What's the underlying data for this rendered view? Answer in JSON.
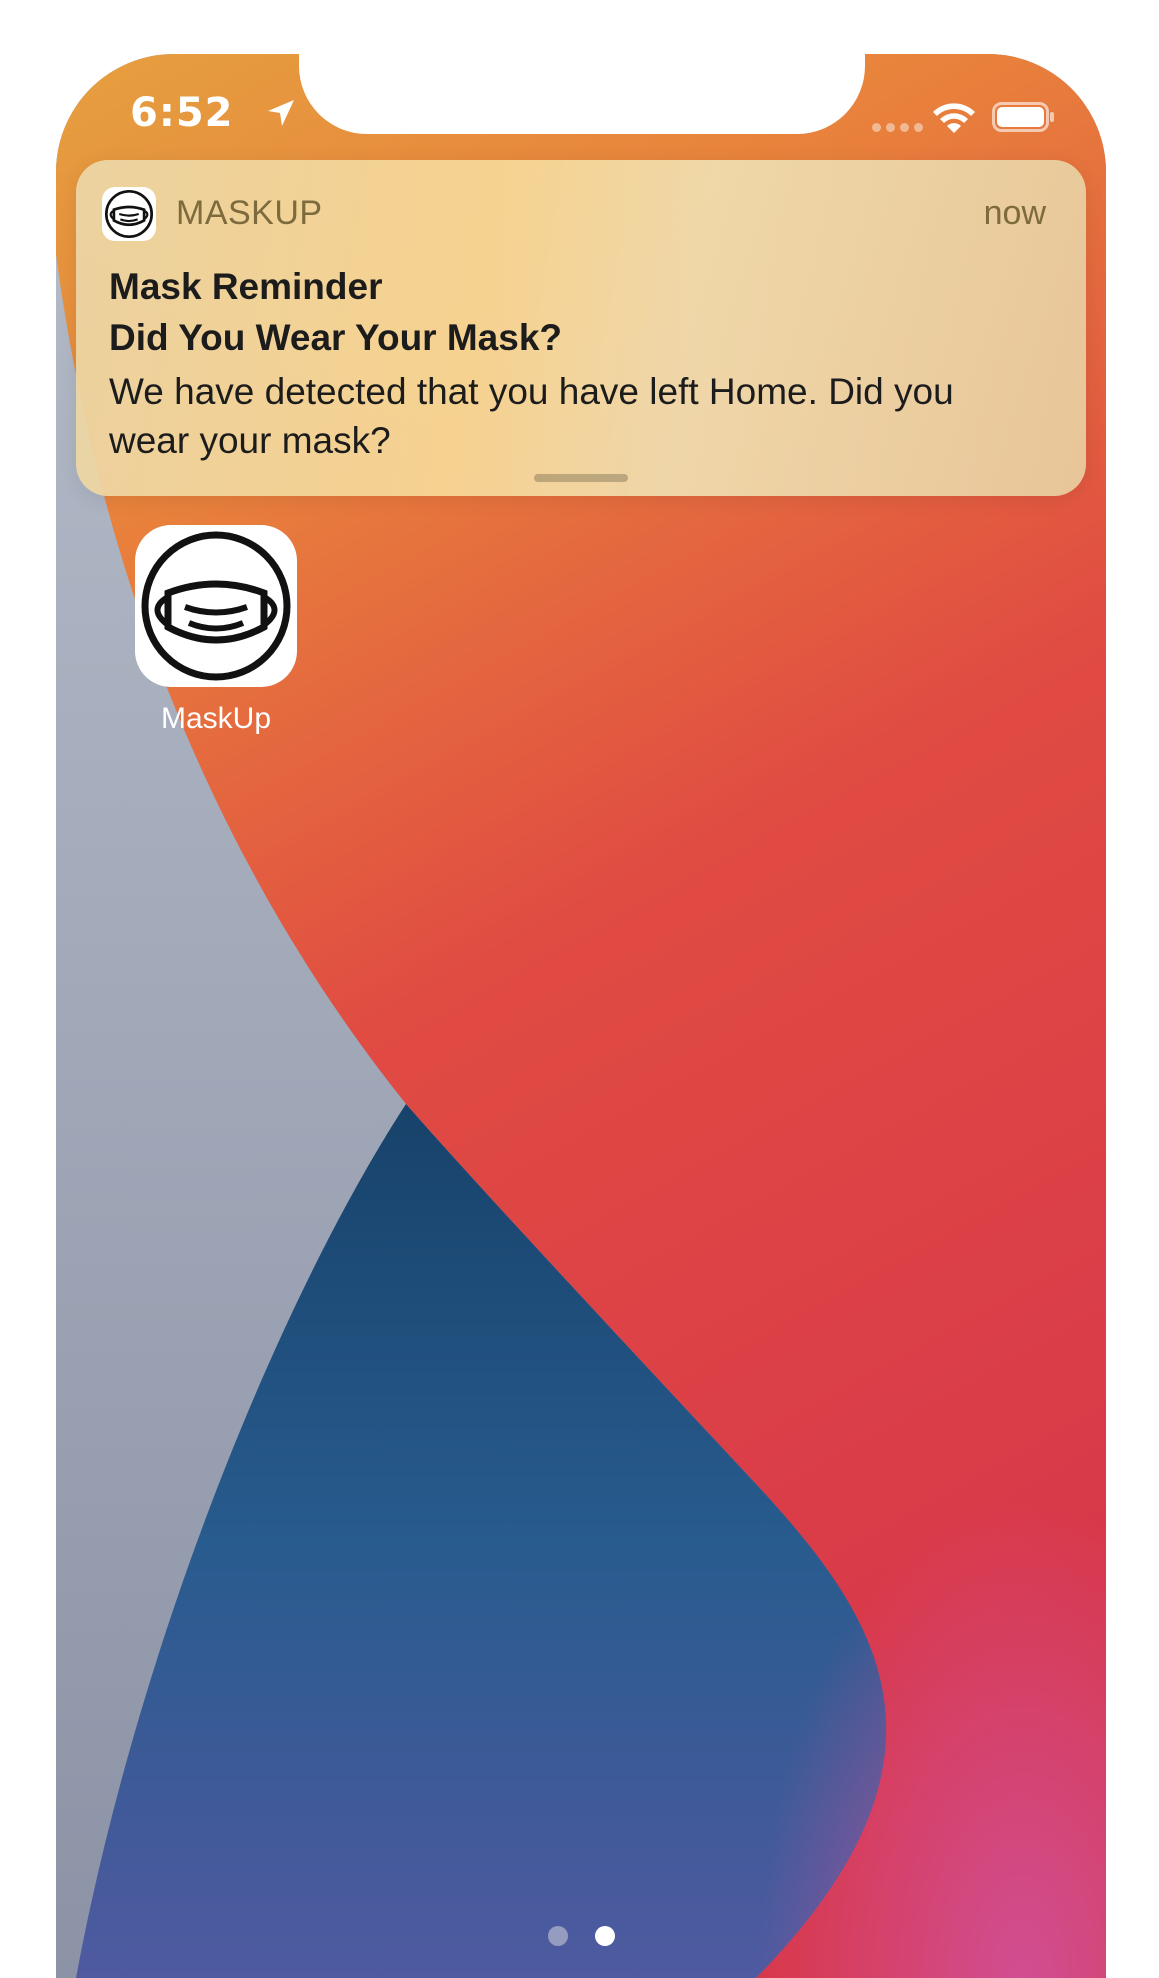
{
  "status_bar": {
    "time": "6:52",
    "location_icon": "location-arrow-icon",
    "wifi_icon": "wifi-icon",
    "battery_icon": "battery-icon"
  },
  "notification": {
    "app_name": "MASKUP",
    "time": "now",
    "title": "Mask Reminder",
    "subtitle": "Did You Wear Your Mask?",
    "body": "We have detected that you have left Home. Did you wear your mask?",
    "icon": "mask-face-icon"
  },
  "home_screen": {
    "apps": [
      {
        "label": "MaskUp",
        "icon": "mask-face-icon"
      }
    ],
    "page_dots": {
      "count": 2,
      "active_index": 1
    }
  },
  "colors": {
    "wallpaper_orange": "#e8823a",
    "wallpaper_red": "#de3a42",
    "wallpaper_blue": "#1f4f7e",
    "wallpaper_gray": "#aab2c3"
  }
}
